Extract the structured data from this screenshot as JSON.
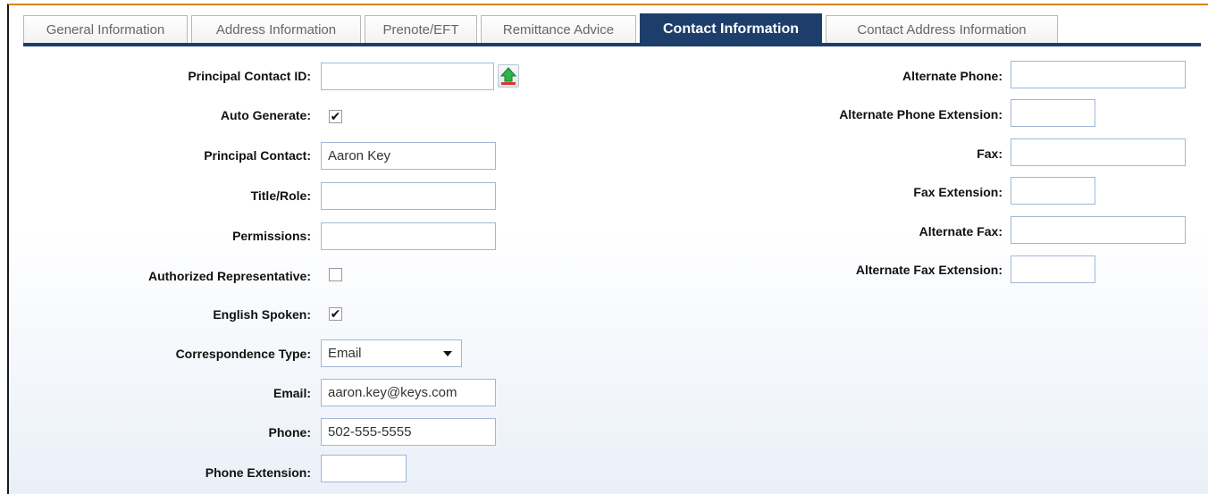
{
  "tabs": [
    {
      "label": "General Information",
      "active": false
    },
    {
      "label": "Address Information",
      "active": false
    },
    {
      "label": "Prenote/EFT",
      "active": false
    },
    {
      "label": "Remittance Advice",
      "active": false
    },
    {
      "label": "Contact Information",
      "active": true
    },
    {
      "label": "Contact Address Information",
      "active": false
    }
  ],
  "left": {
    "principal_contact_id": {
      "label": "Principal Contact ID:",
      "value": ""
    },
    "auto_generate": {
      "label": "Auto Generate:",
      "checked": true,
      "mark": "✔"
    },
    "principal_contact": {
      "label": "Principal Contact:",
      "value": "Aaron Key"
    },
    "title_role": {
      "label": "Title/Role:",
      "value": ""
    },
    "permissions": {
      "label": "Permissions:",
      "value": ""
    },
    "authorized_rep": {
      "label": "Authorized Representative:",
      "checked": false
    },
    "english_spoken": {
      "label": "English Spoken:",
      "checked": true,
      "mark": "✔"
    },
    "correspondence_type": {
      "label": "Correspondence Type:",
      "value": "Email"
    },
    "email": {
      "label": "Email:",
      "value": "aaron.key@keys.com"
    },
    "phone": {
      "label": "Phone:",
      "value": "502-555-5555"
    },
    "phone_extension": {
      "label": "Phone Extension:",
      "value": ""
    }
  },
  "right": {
    "alternate_phone": {
      "label": "Alternate Phone:",
      "value": ""
    },
    "alternate_phone_ext": {
      "label": "Alternate Phone Extension:",
      "value": ""
    },
    "fax": {
      "label": "Fax:",
      "value": ""
    },
    "fax_ext": {
      "label": "Fax Extension:",
      "value": ""
    },
    "alternate_fax": {
      "label": "Alternate Fax:",
      "value": ""
    },
    "alternate_fax_ext": {
      "label": "Alternate Fax Extension:",
      "value": ""
    }
  },
  "icons": {
    "lookup": "upload-arrow-icon",
    "dropdown": "chevron-down-icon"
  },
  "colors": {
    "active_tab": "#1d3e6b",
    "accent_line": "#d4841c",
    "input_border": "#9fb8d6"
  }
}
